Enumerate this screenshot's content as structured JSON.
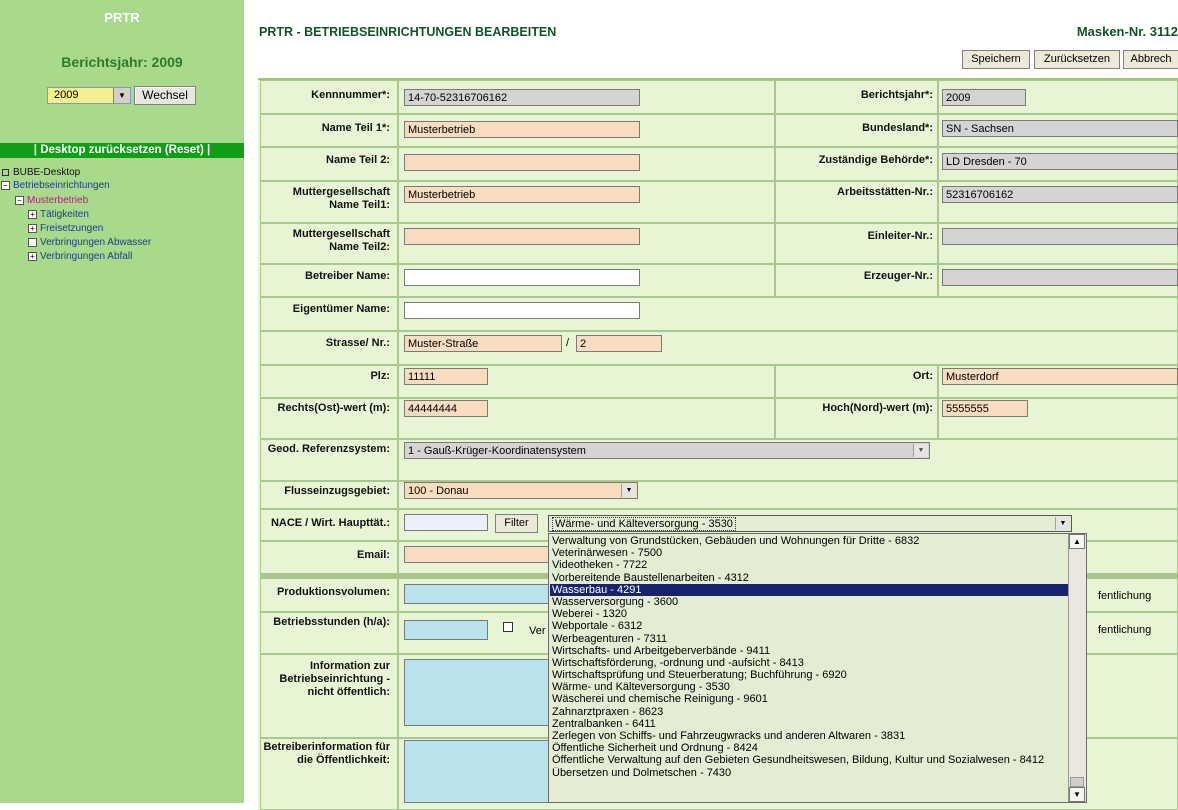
{
  "sidebar": {
    "app_title": "PRTR",
    "year_heading": "Berichtsjahr: 2009",
    "year_select_value": "2009",
    "switch_button": "Wechsel",
    "reset_link": "| Desktop zurücksetzen (Reset) |",
    "tree": {
      "root": "BUBE-Desktop",
      "facilities": "Betriebseinrichtungen",
      "facility": "Musterbetrieb",
      "activities": "Tätigkeiten",
      "releases": "Freisetzungen",
      "wastewater": "Verbringungen Abwasser",
      "waste": "Verbringungen Abfall"
    }
  },
  "header": {
    "title": "PRTR - BETRIEBSEINRICHTUNGEN BEARBEITEN",
    "mask_number": "Masken-Nr. 3112",
    "save": "Speichern",
    "reset": "Zurücksetzen",
    "cancel": "Abbrech"
  },
  "form": {
    "kennnummer_label": "Kennnummer*:",
    "kennnummer_value": "14-70-52316706162",
    "berichtsjahr_label": "Berichtsjahr*:",
    "berichtsjahr_value": "2009",
    "name1_label": "Name Teil 1*:",
    "name1_value": "Musterbetrieb",
    "bundesland_label": "Bundesland*:",
    "bundesland_value": "SN - Sachsen",
    "name2_label": "Name Teil 2:",
    "name2_value": "",
    "behoerde_label": "Zuständige Behörde*:",
    "behoerde_value": "LD Dresden - 70",
    "mutter1_label": "Muttergesellschaft Name Teil1:",
    "mutter1_value": "Musterbetrieb",
    "arbeitsstaetten_label": "Arbeitsstätten-Nr.:",
    "arbeitsstaetten_value": "52316706162",
    "mutter2_label": "Muttergesellschaft Name Teil2:",
    "mutter2_value": "",
    "einleiter_label": "Einleiter-Nr.:",
    "einleiter_value": "",
    "betreiber_label": "Betreiber Name:",
    "betreiber_value": "",
    "erzeuger_label": "Erzeuger-Nr.:",
    "erzeuger_value": "",
    "eigentuemer_label": "Eigentümer Name:",
    "eigentuemer_value": "",
    "strasse_label": "Strasse/ Nr.:",
    "strasse_value": "Muster-Straße",
    "strasse_sep": "/",
    "hausnr_value": "2",
    "plz_label": "Plz:",
    "plz_value": "11111",
    "ort_label": "Ort:",
    "ort_value": "Musterdorf",
    "rechts_label": "Rechts(Ost)-wert (m):",
    "rechts_value": "44444444",
    "hoch_label": "Hoch(Nord)-wert (m):",
    "hoch_value": "5555555",
    "geod_label": "Geod. Referenzsystem:",
    "geod_value": "1 - Gauß-Krüger-Koordinatensystem",
    "fluss_label": "Flusseinzugsgebiet:",
    "fluss_value": "100 - Donau",
    "nace_label": "NACE / Wirt. Haupttät.:",
    "nace_filter_value": "",
    "filter_button": "Filter",
    "nace_value": "Wärme- und Kälteversorgung - 3530",
    "email_label": "Email:",
    "email_value": "",
    "produktion_label": "Produktionsvolumen:",
    "produktion_value": "",
    "betriebsstunden_label": "Betriebsstunden (h/a):",
    "betriebsstunden_value": "",
    "verweigerung_label_partial": "Ver",
    "veroeffentlichung_partial": "fentlichung",
    "information_label": "Information zur Betriebseinrichtung - nicht öffentlich:",
    "betreiberinfo_label": "Betreiberinformation für die Öffentlichkeit:"
  },
  "dropdown": {
    "selected_index": 4,
    "items": [
      "Verwaltung von Grundstücken, Gebäuden und Wohnungen für Dritte - 6832",
      "Veterinärwesen - 7500",
      "Videotheken - 7722",
      "Vorbereitende Baustellenarbeiten - 4312",
      "Wasserbau - 4291",
      "Wasserversorgung - 3600",
      "Weberei - 1320",
      "Webportale - 6312",
      "Werbeagenturen - 7311",
      "Wirtschafts- und Arbeitgeberverbände - 9411",
      "Wirtschaftsförderung, -ordnung und -aufsicht - 8413",
      "Wirtschaftsprüfung und Steuerberatung; Buchführung - 6920",
      "Wärme- und Kälteversorgung - 3530",
      "Wäscherei und chemische Reinigung - 9601",
      "Zahnarztpraxen - 8623",
      "Zentralbanken - 6411",
      "Zerlegen von Schiffs- und Fahrzeugwracks und anderen Altwaren - 3831",
      "Öffentliche Sicherheit und Ordnung - 8424",
      "Öffentliche Verwaltung auf den Gebieten Gesundheitswesen, Bildung, Kultur und Sozialwesen - 8412",
      "Übersetzen und Dolmetschen - 7430"
    ]
  }
}
